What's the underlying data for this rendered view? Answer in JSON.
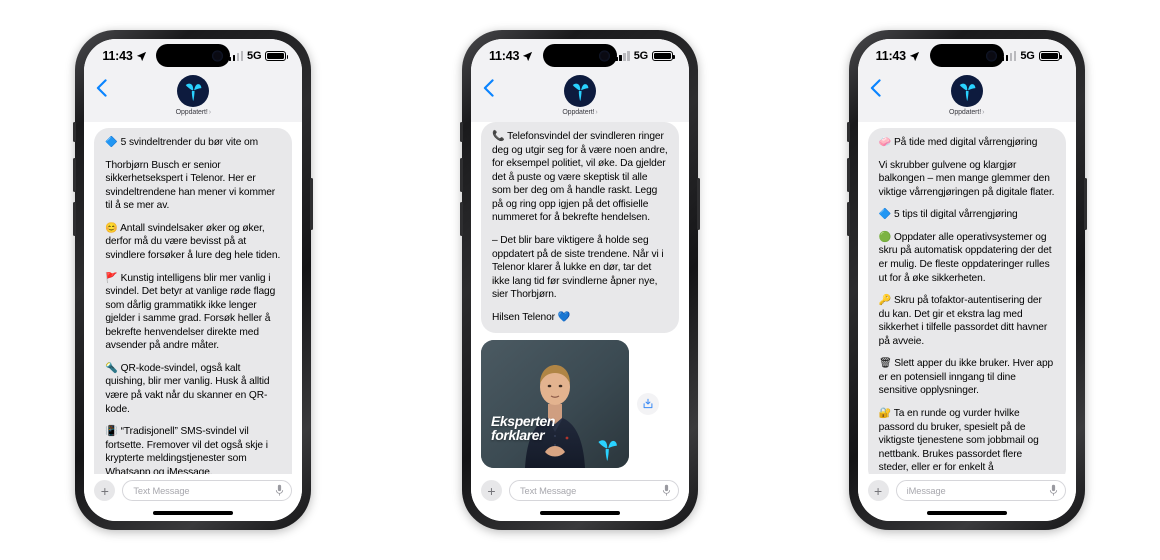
{
  "meta": {
    "accent_blue": "#0a84ff",
    "bubble_gray": "#e8e8ea",
    "telenor_navy": "#0d1b3e",
    "telenor_cyan": "#2ad2ff"
  },
  "status_bar": {
    "time": "11:43",
    "network": "5G",
    "location_icon": "location-arrow-icon",
    "signal_icon": "cellular-bars-icon",
    "battery_icon": "battery-icon"
  },
  "header": {
    "back_icon": "back-chevron-icon",
    "avatar_icon": "telenor-propeller-logo",
    "contact_name": "Oppdatert!",
    "disclosure_icon": "chevron-right-icon"
  },
  "phones": [
    {
      "id": "phone-1",
      "composer": {
        "plus_icon": "plus-icon",
        "placeholder": "Text Message",
        "mic_icon": "microphone-icon"
      },
      "messages": [
        {
          "paragraphs": [
            "🔷 5 svindeltrender du bør vite om",
            "Thorbjørn Busch er senior sikkerhetsekspert i Telenor. Her er svindeltrendene han mener vi kommer til å se mer av.",
            "😊 Antall svindelsaker øker og øker, derfor må du være bevisst på at svindlere forsøker å lure deg hele tiden.",
            "🚩 Kunstig intelligens blir mer vanlig i svindel. Det betyr at vanlige røde flagg som dårlig grammatikk ikke lenger gjelder i samme grad. Forsøk heller å bekrefte henvendelser direkte med avsender på andre måter.",
            "🔦 QR-kode-svindel, også kalt quishing, blir mer vanlig. Husk å alltid være på vakt når du skanner en QR-kode.",
            "📳 “Tradisjonell” SMS-svindel vil fortsette. Fremover vil det også skje i krypterte meldingstjenester som Whatsapp og iMessage."
          ]
        }
      ]
    },
    {
      "id": "phone-2",
      "composer": {
        "plus_icon": "plus-icon",
        "placeholder": "Text Message",
        "mic_icon": "microphone-icon"
      },
      "messages": [
        {
          "paragraphs": [
            "📞 Telefonsvindel der svindleren ringer deg og utgir seg for å være noen andre, for eksempel politiet, vil øke. Da gjelder det å puste og være skeptisk til alle som ber deg om å handle raskt. Legg på og ring opp igjen på det offisielle nummeret for å bekrefte hendelsen.",
            "– Det blir bare viktigere å holde seg oppdatert på de siste trendene. Når vi i Telenor klarer å lukke en dør, tar det ikke lang tid før svindlerne åpner nye, sier Thorbjørn.",
            "Hilsen Telenor 💙"
          ]
        }
      ],
      "media": {
        "caption_line1": "Eksperten",
        "caption_line2": "forklarer",
        "logo_icon": "telenor-propeller-logo",
        "share_icon": "share-save-icon",
        "alt": "video thumbnail of man in dark shirt"
      }
    },
    {
      "id": "phone-3",
      "composer": {
        "plus_icon": "plus-icon",
        "placeholder": "iMessage",
        "mic_icon": "microphone-icon"
      },
      "messages": [
        {
          "paragraphs": [
            "🧼 På tide med digital vårrengjøring",
            "Vi skrubber gulvene og klargjør balkongen – men mange glemmer den viktige vårrengjøringen på digitale flater.",
            "🔷 5 tips til digital vårrengjøring",
            "🟢 Oppdater alle operativsystemer og skru på automatisk oppdatering der det er mulig. De fleste oppdateringer rulles ut for å øke sikkerheten.",
            "🔑 Skru på tofaktor-autentisering der du kan. Det gir et ekstra lag med sikkerhet i tilfelle passordet ditt havner på avveie.",
            "🗑 Slett apper du ikke bruker. Hver app er en potensiell inngang til dine sensitive opplysninger.",
            "🔐 Ta en runde og vurder hvilke passord du bruker, spesielt på de viktigste tjenestene som jobbmail og nettbank. Brukes passordet flere steder, eller er for enkelt å"
          ]
        }
      ]
    }
  ]
}
